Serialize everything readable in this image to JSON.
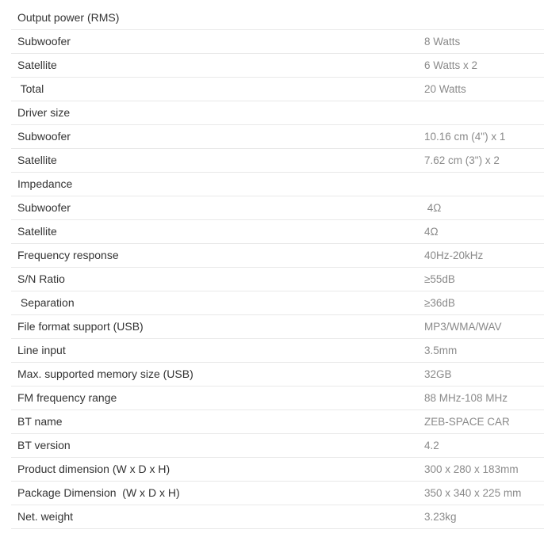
{
  "specs": [
    {
      "label": "Output power (RMS)",
      "value": ""
    },
    {
      "label": "Subwoofer",
      "value": "8 Watts"
    },
    {
      "label": "Satellite",
      "value": "6 Watts x 2"
    },
    {
      "label": " Total",
      "value": "20 Watts"
    },
    {
      "label": "Driver size",
      "value": ""
    },
    {
      "label": "Subwoofer",
      "value": "10.16 cm (4\") x 1"
    },
    {
      "label": "Satellite",
      "value": "7.62 cm (3\") x 2"
    },
    {
      "label": "Impedance",
      "value": ""
    },
    {
      "label": "Subwoofer",
      "value": " 4Ω"
    },
    {
      "label": "Satellite",
      "value": "4Ω"
    },
    {
      "label": "Frequency response",
      "value": "40Hz-20kHz"
    },
    {
      "label": "S/N Ratio",
      "value": "≥55dB"
    },
    {
      "label": " Separation",
      "value": "≥36dB"
    },
    {
      "label": "File format support (USB)",
      "value": "MP3/WMA/WAV"
    },
    {
      "label": "Line input",
      "value": "3.5mm"
    },
    {
      "label": "Max. supported memory size (USB)",
      "value": "32GB"
    },
    {
      "label": "FM frequency range",
      "value": "88 MHz-108 MHz"
    },
    {
      "label": "BT name",
      "value": "ZEB-SPACE CAR"
    },
    {
      "label": "BT version",
      "value": "4.2"
    },
    {
      "label": "Product dimension (W x D x H)",
      "value": "300 x 280 x 183mm"
    },
    {
      "label": "Package Dimension  (W x D x H)",
      "value": "350 x 340 x 225 mm"
    },
    {
      "label": "Net. weight",
      "value": "3.23kg"
    }
  ]
}
